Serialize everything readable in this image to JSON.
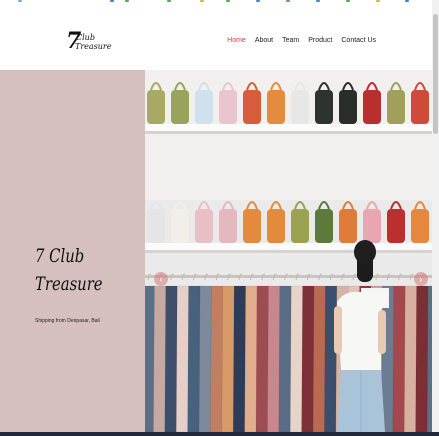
{
  "site": {
    "logo_alt": "7 Club Treasure",
    "brand_color": "#e53935"
  },
  "nav": {
    "items": [
      {
        "label": "Home",
        "active": true
      },
      {
        "label": "About",
        "active": false
      },
      {
        "label": "Team",
        "active": false
      },
      {
        "label": "Product",
        "active": false
      },
      {
        "label": "Contact Us",
        "active": false
      }
    ]
  },
  "hero": {
    "title_line1": "7 Club",
    "title_line2": "Treasure",
    "subtitle": "Shipping from Denpasar, Bali",
    "background_color": "#d6bfbf",
    "image_description_icon": "clothing-store-photo"
  },
  "carousel": {
    "prev_icon": "chevron-left-icon",
    "next_icon": "chevron-right-icon"
  }
}
